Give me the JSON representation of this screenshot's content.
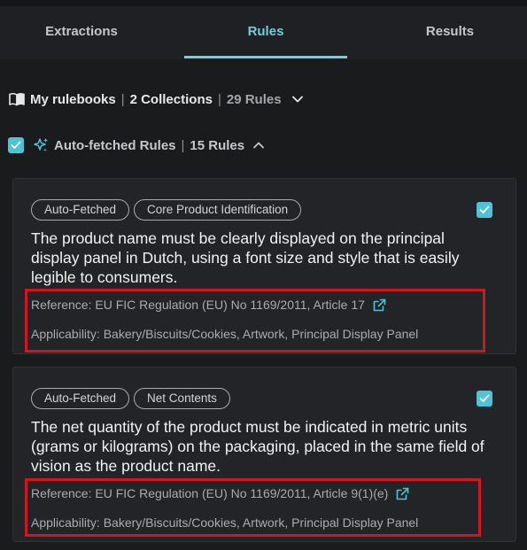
{
  "tabs": [
    {
      "label": "Extractions"
    },
    {
      "label": "Rules"
    },
    {
      "label": "Results"
    }
  ],
  "rulebooks": {
    "title": "My rulebooks",
    "collections": "2 Collections",
    "rules": "29 Rules"
  },
  "autofetched": {
    "title": "Auto-fetched Rules",
    "count": "15 Rules"
  },
  "cards": [
    {
      "tags": [
        "Auto-Fetched",
        "Core Product Identification"
      ],
      "text": "The product name must be clearly displayed on the principal display panel in Dutch, using a font size and style that is easily legible to consumers.",
      "reference": "Reference: EU FIC Regulation (EU) No 1169/2011, Article 17",
      "applicability": "Applicability: Bakery/Biscuits/Cookies, Artwork, Principal Display Panel"
    },
    {
      "tags": [
        "Auto-Fetched",
        "Net Contents"
      ],
      "text": "The net quantity of the product must be indicated in metric units (grams or kilograms) on the packaging, placed in the same field of vision as the product name.",
      "reference": "Reference: EU FIC Regulation (EU) No 1169/2011, Article 9(1)(e)",
      "applicability": "Applicability: Bakery/Biscuits/Cookies, Artwork, Principal Display Panel"
    }
  ],
  "colors": {
    "accent": "#6fcfdc",
    "checkbox": "#4ec3d6",
    "highlight": "#d0161f",
    "background": "#1a1b1d",
    "card": "#232427"
  },
  "icons": {
    "rulebooks": "book-open-icon",
    "rulebooks_toggle": "chevron-down-icon",
    "autofetched": "sparkle-icon",
    "autofetched_toggle": "chevron-up-icon",
    "reference_link": "external-link-icon",
    "checkbox": "check-icon"
  }
}
